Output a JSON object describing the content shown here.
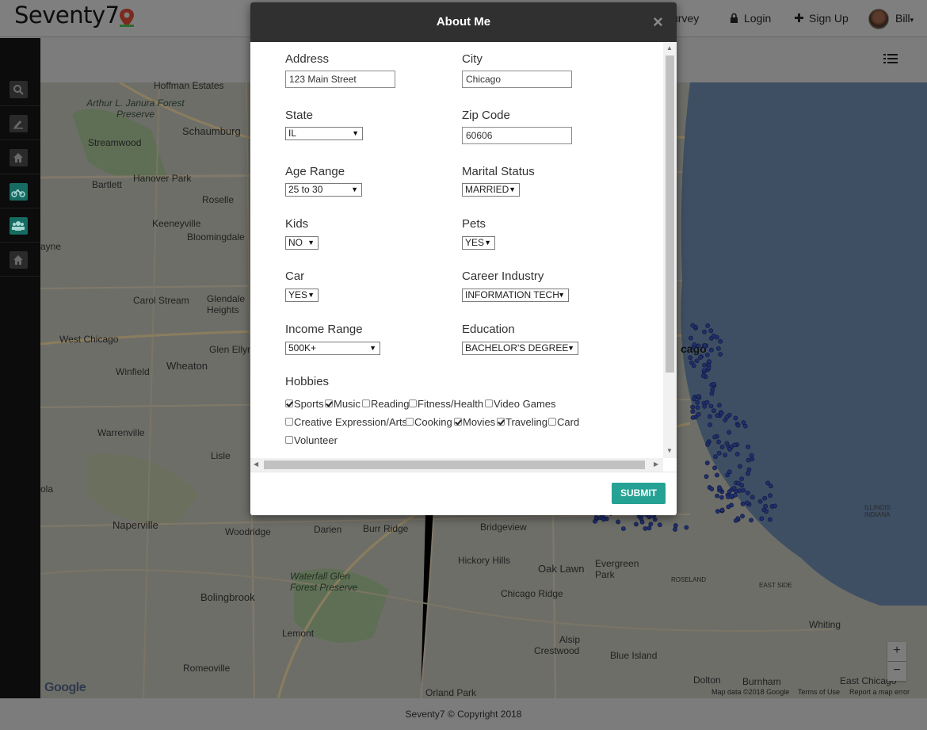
{
  "navbar": {
    "brand": "Seventy7",
    "survey_label": "Survey",
    "survey_visible": "urvey",
    "login_label": "Login",
    "signup_label": "Sign Up",
    "user_name": "Bill"
  },
  "sidebar": {
    "items": [
      {
        "icon": "search-icon"
      },
      {
        "icon": "edit-icon"
      },
      {
        "icon": "home-icon"
      },
      {
        "icon": "bicycle-icon"
      },
      {
        "icon": "group-icon"
      },
      {
        "icon": "home-icon"
      }
    ]
  },
  "map": {
    "labels": {
      "hoffman_estates": "Hoffman Estates",
      "arthur_janura": "Arthur L. Janura Forest Preserve",
      "schaumburg": "Schaumburg",
      "streamwood": "Streamwood",
      "bartlett": "Bartlett",
      "hanover_park": "Hanover Park",
      "roselle": "Roselle",
      "keeneyville": "Keeneyville",
      "bloomingdale": "Bloomingdale",
      "wayne": "ayne",
      "carol_stream": "Carol Stream",
      "glendale_heights": "Glendale Heights",
      "west_chicago": "West Chicago",
      "glen_ellyn": "Glen Ellyn",
      "wheaton": "Wheaton",
      "winfield": "Winfield",
      "warrenville": "Warrenville",
      "lisle": "Lisle",
      "naperville": "Naperville",
      "woodridge": "Woodridge",
      "darien": "Darien",
      "burr_ridge": "Burr Ridge",
      "bridgeview": "Bridgeview",
      "hickory_hills": "Hickory Hills",
      "oak_lawn": "Oak Lawn",
      "evergreen_park": "Evergreen Park",
      "bolingbrook": "Bolingbrook",
      "waterfall_glen": "Waterfall Glen Forest Preserve",
      "chicago_ridge": "Chicago Ridge",
      "lemont": "Lemont",
      "alsip": "Alsip",
      "crestwood": "Crestwood",
      "blue_island": "Blue Island",
      "romeoville": "Romeoville",
      "orland_park": "Orland Park",
      "dolton": "Dolton",
      "burnham": "Burnham",
      "east_chicago": "East Chicago",
      "whiting": "Whiting",
      "chicago": "cago",
      "aurora": "ola",
      "illinois_indiana": "ILLINOIS INDIANA",
      "roseland": "ROSELAND",
      "east_side": "EAST SIDE"
    },
    "attribution": {
      "map_data": "Map data ©2018 Google",
      "terms": "Terms of Use",
      "report": "Report a map error"
    },
    "google_logo": "Google",
    "zoom_in": "+",
    "zoom_out": "−"
  },
  "modal": {
    "title": "About Me",
    "close": "×",
    "address": {
      "label": "Address",
      "value": "123 Main Street"
    },
    "city": {
      "label": "City",
      "value": "Chicago"
    },
    "state": {
      "label": "State",
      "value": "IL"
    },
    "zip": {
      "label": "Zip Code",
      "value": "60606"
    },
    "age_range": {
      "label": "Age Range",
      "value": "25 to 30"
    },
    "marital_status": {
      "label": "Marital Status",
      "value": "MARRIED"
    },
    "kids": {
      "label": "Kids",
      "value": "NO"
    },
    "pets": {
      "label": "Pets",
      "value": "YES"
    },
    "car": {
      "label": "Car",
      "value": "YES"
    },
    "career_industry": {
      "label": "Career Industry",
      "value": "INFORMATION TECH"
    },
    "income_range": {
      "label": "Income Range",
      "value": "500K+"
    },
    "education": {
      "label": "Education",
      "value": "BACHELOR'S DEGREE"
    },
    "hobbies": {
      "label": "Hobbies",
      "items": [
        {
          "label": "Sports",
          "checked": true
        },
        {
          "label": "Music",
          "checked": true
        },
        {
          "label": "Reading",
          "checked": false
        },
        {
          "label": "Fitness/Health",
          "checked": false
        },
        {
          "label": "Video Games",
          "checked": false
        },
        {
          "label": "Creative Expression/Arts",
          "checked": false
        },
        {
          "label": "Cooking",
          "checked": false
        },
        {
          "label": "Movies",
          "checked": true
        },
        {
          "label": "Traveling",
          "checked": true
        },
        {
          "label": "Card",
          "checked": false
        },
        {
          "label": "Volunteer",
          "checked": false
        }
      ]
    },
    "submit_label": "SUBMIT"
  },
  "footer": {
    "copyright": "Seventy7 © Copyright 2018"
  },
  "colors": {
    "accent": "#25a294",
    "modal_header": "#303030",
    "marker": "#1f2f6b"
  }
}
